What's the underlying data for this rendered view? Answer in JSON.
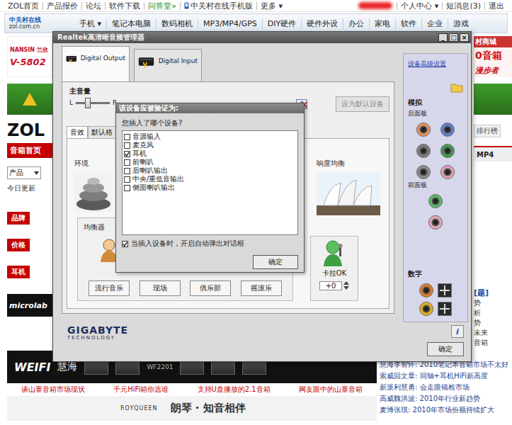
{
  "site": {
    "top_links": [
      {
        "label": "ZOL首页",
        "color": "#333333"
      },
      {
        "label": "产品报价",
        "color": "#333333"
      },
      {
        "label": "论坛",
        "color": "#333333"
      },
      {
        "label": "软件下载",
        "color": "#333333"
      },
      {
        "label": "问答堂»",
        "color": "#0a8a2a"
      }
    ],
    "mobile_link": "中关村在线手机版",
    "more": "更多 ▾",
    "user_links": [
      "个人中心 ▾",
      "短消息(3)",
      "退出"
    ],
    "logo": {
      "cn": "中关村在线",
      "en": "zol.com.cn"
    },
    "nav": [
      "手机 ▾",
      "笔记本电脑",
      "数码相机",
      "MP3/MP4/GPS",
      "DIY硬件",
      "硬件外设",
      "办公",
      "家电",
      "软件",
      "企业",
      "游戏"
    ],
    "left": {
      "ad_brand": "NANSIN",
      "ad_brand_cn": "兰欣",
      "ad_model": "V-5802",
      "zol": "ZOL",
      "channel_tab": "音箱首页",
      "select": "产品",
      "today": "今日更新",
      "filters": [
        "品牌",
        "价格",
        "耳机"
      ],
      "ad_microlab": "microlab"
    },
    "right": {
      "ad_lines": [
        "村商城",
        "0音箱",
        "漫步者"
      ],
      "rank": "排行榜",
      "tab": "MP4",
      "topic": "[题]",
      "snippets": [
        "势",
        "析",
        "势",
        "未来",
        "音箱"
      ]
    },
    "wide_ad": {
      "brand": "WEIFI",
      "brand_cn": "慧海",
      "model": "WF2201"
    },
    "news": [
      "慧海李智怀: 2010笔记本音箱市场不太好",
      "索威回文章: 同轴+耳机HiFi新高度",
      "新派利慧勇: 会走眼镜检市场",
      "高威魏洪波: 2010年行业新趋势",
      "麦博张琪: 2010年市场份额持续扩大"
    ],
    "bottom_links": [
      "谈山寨音箱市场现状",
      "千元HiFi箱你选谁",
      "支持U盘播放的2.1音箱",
      "网友眼中的山寨音箱"
    ],
    "bottom_ad": {
      "brand": "ROYQUEEN",
      "slogan": "朗琴 · 知音相伴"
    }
  },
  "window": {
    "title": "Realtek高清晰音频管理器",
    "controls": [
      "_",
      "□",
      "×"
    ],
    "device_tabs": [
      {
        "label": "Digital Output",
        "selected": true
      },
      {
        "label": "Digital Input",
        "selected": false
      }
    ],
    "master_volume": {
      "label": "主音量",
      "left": "L",
      "right": "R",
      "level": 0.35,
      "muted": true
    },
    "default_button": {
      "label": "设为默认设备",
      "disabled": true
    },
    "sub_tabs": [
      {
        "label": "音效",
        "selected": true
      },
      {
        "label": "默认格",
        "selected": false
      }
    ],
    "environment": {
      "label": "环境"
    },
    "loudness": {
      "label": "响度均衡"
    },
    "equalizer": {
      "label": "均衡器",
      "presets": [
        "流行音乐",
        "现场",
        "俱乐部",
        "摇滚乐"
      ]
    },
    "karaoke": {
      "label": "卡拉OK",
      "value": "+0"
    },
    "side_panel": {
      "link": "设备高级设置",
      "analog": "模拟",
      "rear": "后面板",
      "rear_jacks": [
        {
          "color": "#e8935f"
        },
        {
          "color": "#5f7fd0"
        },
        {
          "color": "#7c7c7c"
        },
        {
          "color": "#3e9e4a"
        },
        {
          "color": "#8c8c8c"
        },
        {
          "color": "#e0a3b6"
        }
      ],
      "front": "前面板",
      "front_jacks": [
        {
          "color": "#5cb86a"
        },
        {
          "color": "#e3a8b8"
        }
      ],
      "digital": "数字",
      "digital_jacks": [
        {
          "color": "#e07a2a"
        },
        {
          "color": "#e0b020"
        }
      ]
    },
    "brand": {
      "name": "GIGABYTE",
      "sub": "TECHNOLOGY"
    },
    "info_button": "i",
    "ok_button": "确定"
  },
  "dialog": {
    "title": "该设备应被验证为:",
    "question": "您插入了哪个设备?",
    "devices": [
      {
        "label": "音源输入",
        "checked": false
      },
      {
        "label": "麦克风",
        "checked": false
      },
      {
        "label": "耳机",
        "checked": true
      },
      {
        "label": "前喇叭",
        "checked": false
      },
      {
        "label": "后喇叭输出",
        "checked": false
      },
      {
        "label": "中央/重低音输出",
        "checked": false
      },
      {
        "label": "侧面喇叭输出",
        "checked": false
      }
    ],
    "auto_popup": {
      "label": "当插入设备时，开启自动弹出对话框",
      "checked": true
    },
    "ok_button": "确定"
  }
}
